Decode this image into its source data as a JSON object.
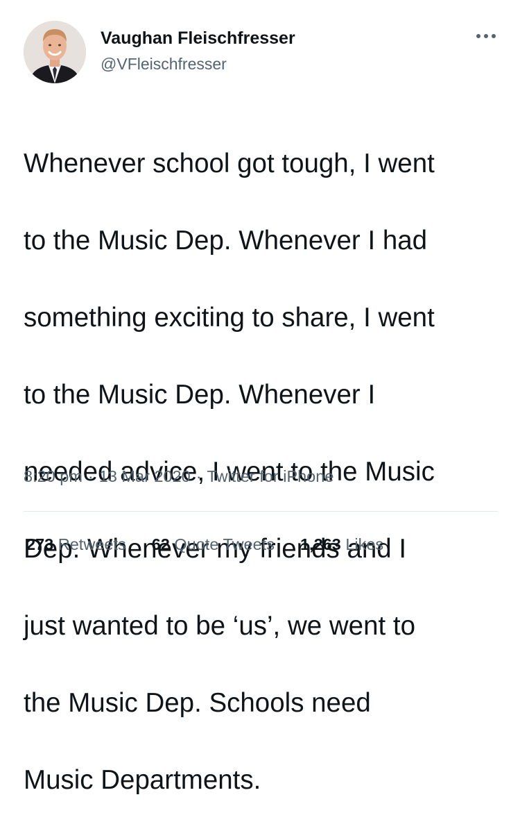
{
  "user": {
    "display_name": "Vaughan Fleischfresser",
    "handle": "@VFleischfresser"
  },
  "tweet": {
    "text_lines": [
      "Whenever school got tough, I went",
      "to the Music Dep. Whenever I had",
      "something exciting to share, I went",
      "to the Music Dep. Whenever I",
      "needed advice, I went to the Music",
      "Dep. Whenever my friends and I",
      "just wanted to be ‘us’, we went to",
      "the Music Dep. Schools need",
      "Music Departments."
    ],
    "time": "8:20 pm",
    "date": "13 Mar 2020",
    "source": "Twitter for iPhone",
    "separator": "·"
  },
  "stats": {
    "retweets_count": "273",
    "retweets_label": "Retweets",
    "quotes_count": "62",
    "quotes_label": "Quote Tweets",
    "likes_count": "1,263",
    "likes_label": "Likes"
  },
  "icons": {
    "more": "more-options-icon"
  },
  "colors": {
    "text_primary": "#0f1419",
    "text_secondary": "#536471",
    "divider": "#e1e8ed"
  }
}
